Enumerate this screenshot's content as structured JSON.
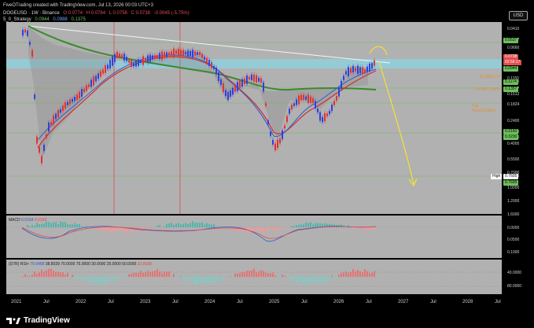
{
  "header": {
    "line1": "FiveOTrading created with TradingView.com, Jul 13, 2026 00:03 UTC+3",
    "symbol": "DOGEUSD · 1W · Binance",
    "ohlc": [
      "O 0.0774",
      "H 0.0784",
      "L 0.0756",
      "C 0.0738",
      "-0.0045 (-5.75%)"
    ],
    "strategy_label": "5_0_Strategy",
    "strategy_values": [
      "0.0944",
      "0.0988",
      "0.1375"
    ]
  },
  "currency_button": "USD",
  "price_axis_labels": [
    "0.0410",
    "0.0537",
    "0.0660",
    "0.1150",
    "0.1174",
    "0.1357",
    "0.1512",
    "0.1824",
    "0.2400",
    "0.3160",
    "0.3230",
    "0.4000",
    "0.5500",
    "0.7000",
    "0.7605",
    "1.0000",
    "1.2000",
    "1.6000"
  ],
  "price_tags": {
    "last": "0.0738",
    "countdown": "02:56:17",
    "ma": "0.0944",
    "level1": "0.0537",
    "level2": "0.1357",
    "level3": "0.3160",
    "level4": "0.3230",
    "high": "0.7605",
    "high_label": "High",
    "fib": "0.1174"
  },
  "fib_labels": [
    "0.236(0.1174)",
    "0.618(0.1357)",
    "Fair Price(0.1824)"
  ],
  "macd": {
    "title": "MACD",
    "values": [
      "0.0154",
      "0.0159"
    ],
    "axis": [
      "0.0000",
      "0.0500",
      "0.1000"
    ]
  },
  "rsi": {
    "title": "(D7R) RSI+",
    "values": [
      "79.6468",
      "38.8039",
      "70.0000",
      "75.0000",
      "30.0000",
      "25.0000",
      "50.0000",
      "33.8688"
    ],
    "axis": [
      "40.0000",
      "80.0000"
    ]
  },
  "time_axis": [
    "2021",
    "Jul",
    "2022",
    "Jul",
    "2023",
    "Jul",
    "2024",
    "Jul",
    "2025",
    "Jul",
    "2026",
    "Jul",
    "2027",
    "Jul",
    "2028",
    "Jul"
  ],
  "logo_text": "TradingView",
  "colors": {
    "up": "#2e3fe0",
    "down": "#e0322e",
    "ma_green": "#3a8a2e",
    "ma_red": "#d42b2b",
    "band": "#86c4d6",
    "arrow": "#f2df3a"
  }
}
